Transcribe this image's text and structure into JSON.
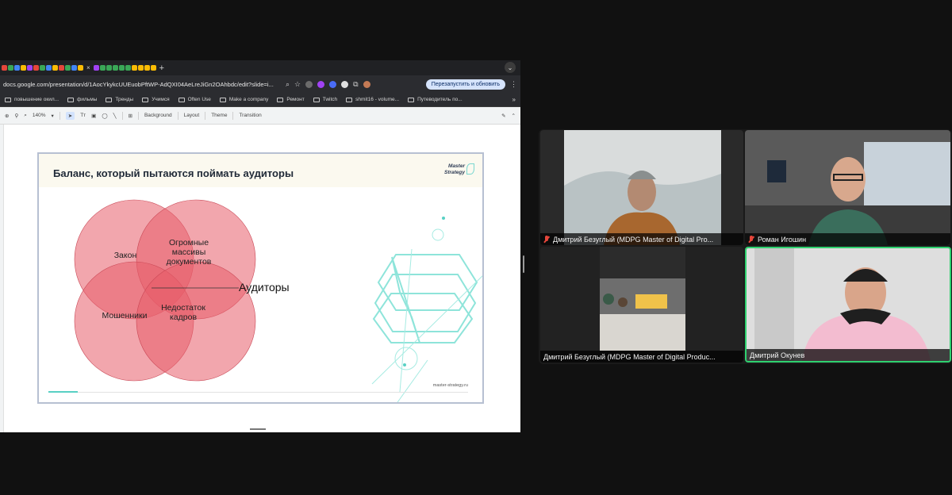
{
  "browser": {
    "tab_close_glyph": "×",
    "new_tab_glyph": "+",
    "tab_menu_glyph": "⌄",
    "url": "docs.google.com/presentation/d/1AocYkykcUUEuobPftWP-AdQXI04AeLreJiGn2OAhbdc/edit?slide=i...",
    "relaunch_label": "Перезапустить и обновить",
    "bookmarks": [
      "повышение окил...",
      "фильмы",
      "Тренды",
      "Учимся",
      "Often Use",
      "Make a company",
      "Ремонт",
      "Twitch",
      "shmit16 - volume...",
      "Путеводитель по..."
    ],
    "bookmarks_more": "»",
    "favicon_colors": [
      "#e5463b",
      "#3aa757",
      "#4285f4",
      "#fbbc04",
      "#a142f4",
      "#e5463b",
      "#3aa757",
      "#4285f4",
      "#fbbc04",
      "#e5463b",
      "#3aa757",
      "#4285f4",
      "#fbbc04",
      "#a142f4",
      "#3aa757",
      "#3aa757",
      "#3aa757",
      "#3aa757",
      "#3aa757",
      "#fbbc04",
      "#fbbc04",
      "#fbbc04",
      "#fbbc04"
    ]
  },
  "toolbar": {
    "zoom": "140%",
    "background": "Background",
    "layout": "Layout",
    "theme": "Theme",
    "transition": "Transition"
  },
  "slide": {
    "title": "Баланс, который пытаются поймать аудиторы",
    "brand_line1": "Master",
    "brand_line2": "Strategy",
    "venn_labels": {
      "law": "Закон",
      "documents": "Огромные\nмассивы\nдокументов",
      "fraudsters": "Мошенники",
      "shortage": "Недостаток\nкадров"
    },
    "auditors": "Аудиторы",
    "footer_url": "master-strategy.ru",
    "progress": 0.07,
    "venn_fill": "#e85c6a",
    "accent": "#58d0c4"
  },
  "participants": [
    {
      "name": "Дмитрий Безуглый (MDPG Master of Digital Pro...",
      "muted": true,
      "speaking": false
    },
    {
      "name": "Роман Игошин",
      "muted": true,
      "speaking": false
    },
    {
      "name": "Дмитрий Безуглый (MDPG Master of Digital Produc...",
      "muted": false,
      "speaking": false
    },
    {
      "name": "Дмитрий Окунев",
      "muted": false,
      "speaking": true
    }
  ]
}
